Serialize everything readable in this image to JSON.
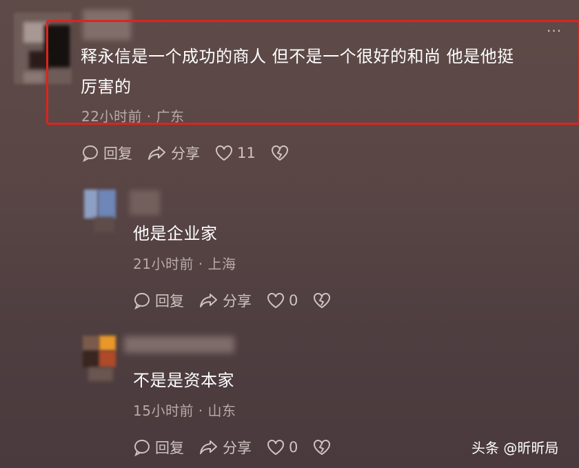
{
  "comments": [
    {
      "text_line1": "释永信是一个成功的商人 但不是一个很好的和尚 他是他挺",
      "text_line2": "厉害的",
      "time_location": "22小时前 · 广东",
      "reply_label": "回复",
      "share_label": "分享",
      "likes": "11"
    }
  ],
  "replies": [
    {
      "text": "他是企业家",
      "time_location": "21小时前 · 上海",
      "reply_label": "回复",
      "share_label": "分享",
      "likes": "0"
    },
    {
      "text": "不是是资本家",
      "time_location": "15小时前 · 山东",
      "reply_label": "回复",
      "share_label": "分享",
      "likes": "0"
    }
  ],
  "watermark": "头条 @昕昕局",
  "colors": {
    "highlight": "#e0221e"
  }
}
